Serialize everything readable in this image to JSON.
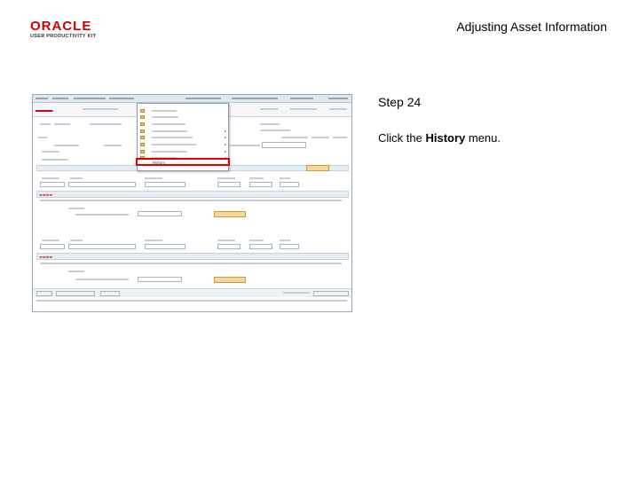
{
  "logo": {
    "word": "ORACLE",
    "subtitle": "USER PRODUCTIVITY KIT"
  },
  "slide_title": "Adjusting Asset Information",
  "step": "Step 24",
  "instruction": {
    "before": "Click the ",
    "target": "History",
    "after": " menu."
  },
  "screenshot": {
    "highlight_label": "History",
    "colors": {
      "highlight": "#e00000",
      "brand_red": "#cc0000",
      "menubar": "#dfe7f1",
      "button": "#f5d79e"
    }
  }
}
